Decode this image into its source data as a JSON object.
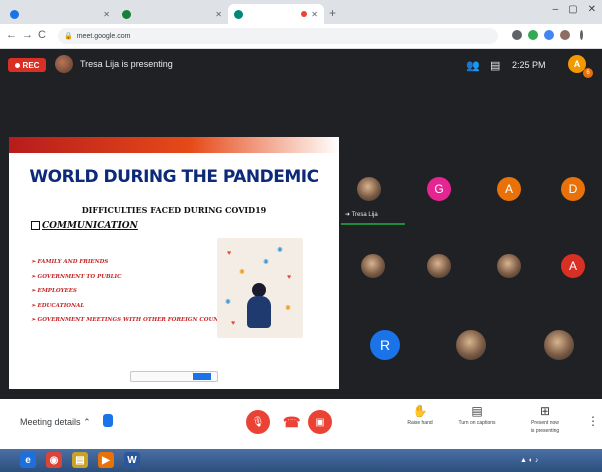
{
  "browser": {
    "tabs": [
      {
        "title": "",
        "favicon_color": "#1a73e8",
        "active": false
      },
      {
        "title": "",
        "favicon_color": "#188038",
        "active": false
      },
      {
        "title": "",
        "favicon_color": "#00897b",
        "active": true
      }
    ],
    "new_tab_label": "+",
    "window_controls": {
      "minimize": "–",
      "maximize": "▢",
      "close": "✕"
    },
    "nav": {
      "back": "←",
      "forward": "→",
      "reload": "C"
    },
    "address": "meet.google.com"
  },
  "meet": {
    "rec_label": "REC",
    "presenting_text": "Tresa Lija is presenting",
    "clock": "2:25 PM",
    "self_initial": "A",
    "notification_count": "6",
    "speaking_name": "Tresa Lija",
    "participants": [
      {
        "initial": "",
        "color": "photo"
      },
      {
        "initial": "G",
        "color": "#e52592"
      },
      {
        "initial": "A",
        "color": "#e8710a"
      },
      {
        "initial": "D",
        "color": "#e8710a"
      },
      {
        "initial": "",
        "color": "photo"
      },
      {
        "initial": "",
        "color": "photo"
      },
      {
        "initial": "",
        "color": "photo"
      },
      {
        "initial": "A",
        "color": "#d93025"
      },
      {
        "initial": "R",
        "color": "#1a73e8"
      },
      {
        "initial": "",
        "color": "photo"
      },
      {
        "initial": "",
        "color": "photo"
      }
    ],
    "controls": {
      "meeting_details": "Meeting details",
      "raise_hand": "Raise hand",
      "captions": "Turn on captions",
      "present": "Present now",
      "present_sub": "is presenting"
    }
  },
  "slide": {
    "title": "WORLD DURING THE PANDEMIC",
    "subtitle": "DIFFICULTIES FACED DURING COVID19",
    "heading": "COMMUNICATION",
    "bullets": [
      "FAMILY AND FRIENDS",
      "GOVERNMENT TO PUBLIC",
      "EMPLOYEES",
      "EDUCATIONAL",
      "GOVERNMENT MEETINGS WITH OTHER FOREIGN COUNTRIES"
    ]
  },
  "taskbar": {
    "icons": [
      {
        "glyph": "e",
        "color": "#1e6fd9"
      },
      {
        "glyph": "◉",
        "color": "#db4437"
      },
      {
        "glyph": "▤",
        "color": "#c9a227"
      },
      {
        "glyph": "▶",
        "color": "#e8710a"
      },
      {
        "glyph": "W",
        "color": "#2b579a"
      }
    ]
  }
}
